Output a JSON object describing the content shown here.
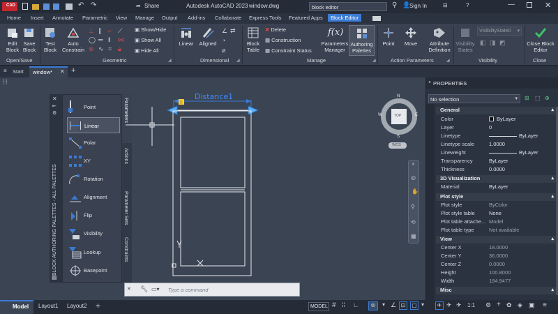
{
  "titlebar": {
    "app_badge": "CAD",
    "title": "Autodesk AutoCAD 2023",
    "filename": "window.dwg",
    "search_value": "block editor",
    "sign_in": "Sign In",
    "share": "Share"
  },
  "ribbon_tabs": [
    "Home",
    "Insert",
    "Annotate",
    "Parametric",
    "View",
    "Manage",
    "Output",
    "Add-ins",
    "Collaborate",
    "Express Tools",
    "Featured Apps",
    "Block Editor"
  ],
  "active_tab": "Block Editor",
  "ribbon": {
    "open_save": {
      "title": "Open/Save",
      "edit_block": "Edit Block",
      "save_block": "Save Block"
    },
    "geometric": {
      "title": "Geometric",
      "test_block": "Test Block",
      "auto_constrain": "Auto Constrain",
      "show_hide": "Show/Hide",
      "show_all": "Show All",
      "hide_all": "Hide All"
    },
    "dimensional": {
      "title": "Dimensional",
      "linear": "Linear",
      "aligned": "Aligned"
    },
    "manage": {
      "title": "Manage",
      "block_table": "Block Table",
      "delete": "Delete",
      "construction": "Construction",
      "constraint_status": "Constraint Status",
      "parameters_manager": "Parameters Manager",
      "authoring_palettes": "Authoring Palettes"
    },
    "action_parameters": {
      "title": "Action Parameters",
      "point": "Point",
      "move": "Move",
      "attribute_definition": "Attribute Definition"
    },
    "visibility": {
      "title": "Visibility",
      "visibility_states": "Visibility States",
      "visibility_state_value": "VisibilityState0"
    },
    "close": {
      "title": "Close",
      "close_block_editor": "Close Block Editor"
    }
  },
  "doc_tabs": [
    "Start",
    "window*"
  ],
  "palette": {
    "vertical_title": "BLOCK AUTHORING PALETTES - ALL PALETTES",
    "side_tabs": [
      "Parameters",
      "Actions",
      "Parameter Sets",
      "Constraints"
    ],
    "items": [
      "Point",
      "Linear",
      "Polar",
      "XY",
      "Rotation",
      "Alignment",
      "Flip",
      "Visibility",
      "Lookup",
      "Basepoint"
    ],
    "selected": "Linear"
  },
  "drawing": {
    "dimension_label": "Distance1",
    "viewcube": {
      "n": "N",
      "s": "S",
      "e": "E",
      "w": "W",
      "face": "TOP",
      "wcs": "WCS"
    }
  },
  "command_line": {
    "placeholder": "Type a command"
  },
  "properties": {
    "header": "PROPERTIES",
    "selection": "No selection",
    "sections": {
      "general": {
        "title": "General",
        "rows": [
          {
            "k": "Color",
            "v": "ByLayer"
          },
          {
            "k": "Layer",
            "v": "0"
          },
          {
            "k": "Linetype",
            "v": "ByLayer"
          },
          {
            "k": "Linetype scale",
            "v": "1.0000"
          },
          {
            "k": "Lineweight",
            "v": "ByLayer"
          },
          {
            "k": "Transparency",
            "v": "ByLayer"
          },
          {
            "k": "Thickness",
            "v": "0.0000"
          }
        ]
      },
      "viz3d": {
        "title": "3D Visualization",
        "rows": [
          {
            "k": "Material",
            "v": "ByLayer"
          }
        ]
      },
      "plot": {
        "title": "Plot style",
        "rows": [
          {
            "k": "Plot style",
            "v": "ByColor"
          },
          {
            "k": "Plot style table",
            "v": "None"
          },
          {
            "k": "Plot table attache...",
            "v": "Model"
          },
          {
            "k": "Plot table type",
            "v": "Not available"
          }
        ]
      },
      "view": {
        "title": "View",
        "rows": [
          {
            "k": "Center X",
            "v": "18.0000"
          },
          {
            "k": "Center Y",
            "v": "36.0000"
          },
          {
            "k": "Center Z",
            "v": "0.0000"
          },
          {
            "k": "Height",
            "v": "100.8000"
          },
          {
            "k": "Width",
            "v": "184.9477"
          }
        ]
      },
      "misc": {
        "title": "Misc"
      }
    }
  },
  "statusbar": {
    "tabs": [
      "Model",
      "Layout1",
      "Layout2"
    ],
    "model_btn": "MODEL",
    "scale": "1:1"
  }
}
